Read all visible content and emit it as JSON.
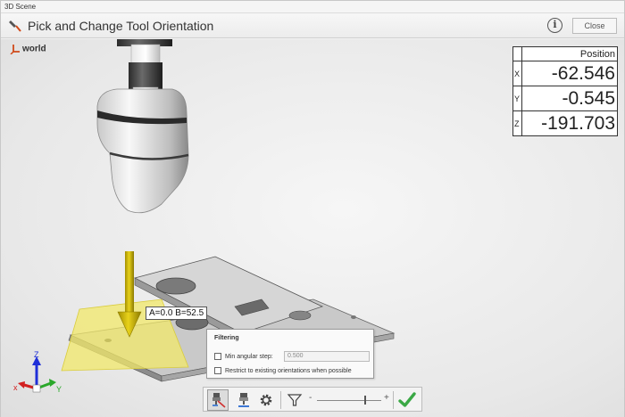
{
  "window": {
    "title": "3D Scene"
  },
  "header": {
    "title": "Pick and Change Tool Orientation",
    "info_label": "i",
    "close_label": "Close"
  },
  "scene": {
    "frame_label": "world",
    "orientation_label": "A=0.0 B=52.5",
    "triad": {
      "x": "x",
      "y": "Y",
      "z": "Z"
    }
  },
  "position_table": {
    "header": "Position",
    "rows": [
      {
        "axis": "X",
        "value": "-62.546"
      },
      {
        "axis": "Y",
        "value": "-0.545"
      },
      {
        "axis": "Z",
        "value": "-191.703"
      }
    ]
  },
  "filtering": {
    "title": "Filtering",
    "min_angular_step_label": "Min angular step:",
    "min_angular_step_value": "0.500",
    "min_angular_step_checked": false,
    "restrict_label": "Restrict to existing orientations when possible",
    "restrict_checked": false
  },
  "toolbar": {
    "slider_minus": "-",
    "slider_plus": "+",
    "slider_level": 0.75,
    "icons": [
      "pick-orientation-icon",
      "robot-tool-icon",
      "gear-icon",
      "filter-icon",
      "checkmark-icon"
    ]
  },
  "colors": {
    "accent_check": "#3aa845",
    "arrow": "#c9b400",
    "pick_plane": "#f2e86a"
  }
}
